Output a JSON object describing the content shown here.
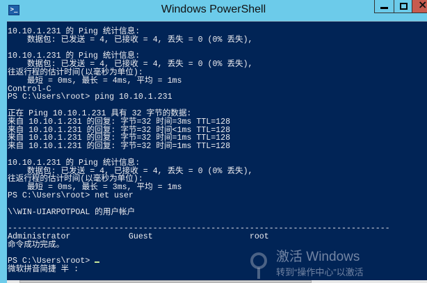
{
  "window": {
    "title": "Windows PowerShell",
    "icon": "powershell-icon"
  },
  "console": {
    "lines": [
      "10.10.1.231 的 Ping 统计信息:",
      "    数据包: 已发送 = 4, 已接收 = 4, 丢失 = 0 (0% 丢失),",
      "",
      "10.10.1.231 的 Ping 统计信息:",
      "    数据包: 已发送 = 4, 已接收 = 4, 丢失 = 0 (0% 丢失),",
      "往返行程的估计时间(以毫秒为单位):",
      "    最短 = 0ms, 最长 = 4ms, 平均 = 1ms",
      "Control-C",
      "PS C:\\Users\\root> ping 10.10.1.231",
      "",
      "正在 Ping 10.10.1.231 具有 32 字节的数据:",
      "来自 10.10.1.231 的回复: 字节=32 时间=3ms TTL=128",
      "来自 10.10.1.231 的回复: 字节=32 时间<1ms TTL=128",
      "来自 10.10.1.231 的回复: 字节=32 时间=1ms TTL=128",
      "来自 10.10.1.231 的回复: 字节=32 时间=1ms TTL=128",
      "",
      "10.10.1.231 的 Ping 统计信息:",
      "    数据包: 已发送 = 4, 已接收 = 4, 丢失 = 0 (0% 丢失),",
      "往返行程的估计时间(以毫秒为单位):",
      "    最短 = 0ms, 最长 = 3ms, 平均 = 1ms",
      "PS C:\\Users\\root> net user",
      "",
      "\\\\WIN-UIARPOTPOAL 的用户帐户",
      "",
      "-------------------------------------------------------------------------------",
      "Administrator            Guest                    root",
      "命令成功完成。",
      ""
    ],
    "prompt": "PS C:\\Users\\root>",
    "ime_status": "微软拼音简捷 半 :"
  },
  "watermark": {
    "title": "激活 Windows",
    "subtitle": "转到“操作中心”以激活"
  },
  "colors": {
    "background": "#012456",
    "titlebar": "#6ccbea",
    "close": "#c75b4f"
  }
}
